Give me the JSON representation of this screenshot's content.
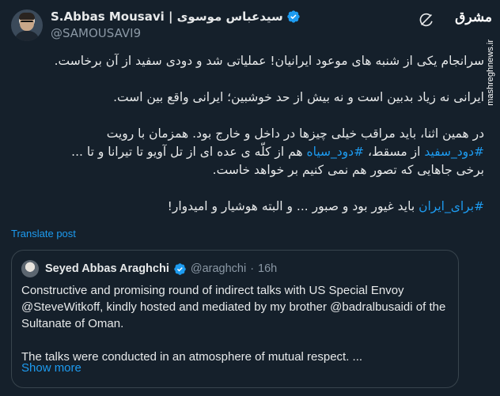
{
  "author": {
    "display_name": "S.Abbas Mousavi | سیدعباس موسوی",
    "handle": "@SAMOUSAVI9",
    "verified": true
  },
  "icons": {
    "avatar": "user-avatar",
    "verified": "verified-badge-icon",
    "grok": "grok-icon",
    "quote_avatar": "user-avatar",
    "quote_verified": "verified-badge-icon"
  },
  "tweet": {
    "line1": "سرانجام یکی از شنبه های موعود ایرانیان! عملیاتی شد و دودی سفید از آن برخاست.",
    "line2": "ایرانی نه زیاد بدبین است و نه بیش از حد خوشبین؛ ایرانی واقع بین است.",
    "line3": "در همین اثنا، باید مراقب خیلی چیزها در داخل و خارج بود. همزمان با رویت",
    "hashtag1": "#دود_سفید",
    "line4_mid": " از مسقط، ",
    "hashtag2": "#دود_سیاه",
    "line4_end": " هم از کلّه ی عده ای از تل آویو تا تیرانا و تا ...",
    "line5": "برخی جاهایی که تصور هم نمی کنیم بر خواهد خاست.",
    "hashtag3": "#برای_ایران",
    "line6_end": " باید غیور بود و صبور ... و البته هوشیار و امیدوار!"
  },
  "translate_label": "Translate post",
  "quote": {
    "display_name": "Seyed Abbas Araghchi",
    "handle": "@araghchi",
    "separator": "·",
    "time": "16h",
    "paragraph1": "Constructive and promising round of indirect talks with US Special Envoy @SteveWitkoff, kindly hosted and mediated by my brother @badralbusaidi of the Sultanate of Oman.",
    "paragraph2": "The talks were conducted in an atmosphere of mutual respect. ...",
    "show_more": "Show more"
  },
  "logo": {
    "brand": "مشرق",
    "site": "mashreghnews.ir"
  },
  "colors": {
    "background": "#15202b",
    "text": "#e7e9ea",
    "muted": "#8b98a5",
    "accent": "#1d9bf0",
    "border": "#38444d"
  }
}
